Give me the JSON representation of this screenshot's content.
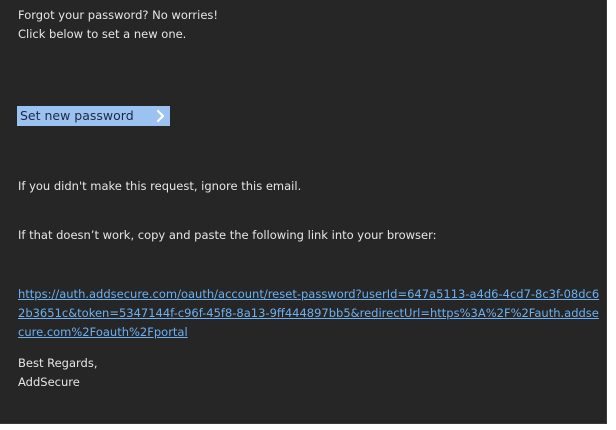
{
  "email": {
    "line1": "Forgot your password? No worries!",
    "line2": "Click below to set a new one.",
    "button_label": "Set new password",
    "button_icon": "chevron-right-icon",
    "ignore_text": "If you didn't make this request, ignore this email.",
    "fallback_text": "If that doesn’t work, copy and paste the following link into your browser:",
    "reset_link": "https://auth.addsecure.com/oauth/account/reset-password?userId=647a5113-a4d6-4cd7-8c3f-08dc62b3651c&token=5347144f-c96f-45f8-8a13-9ff444897bb5&redirectUrl=https%3A%2F%2Fauth.addsecure.com%2Foauth%2Fportal",
    "sign_off": "Best Regards,",
    "sender": "AddSecure"
  },
  "colors": {
    "background": "#262626",
    "text": "#e6e6e6",
    "button_bg": "#9bc2f0",
    "link": "#6cb0f2"
  }
}
